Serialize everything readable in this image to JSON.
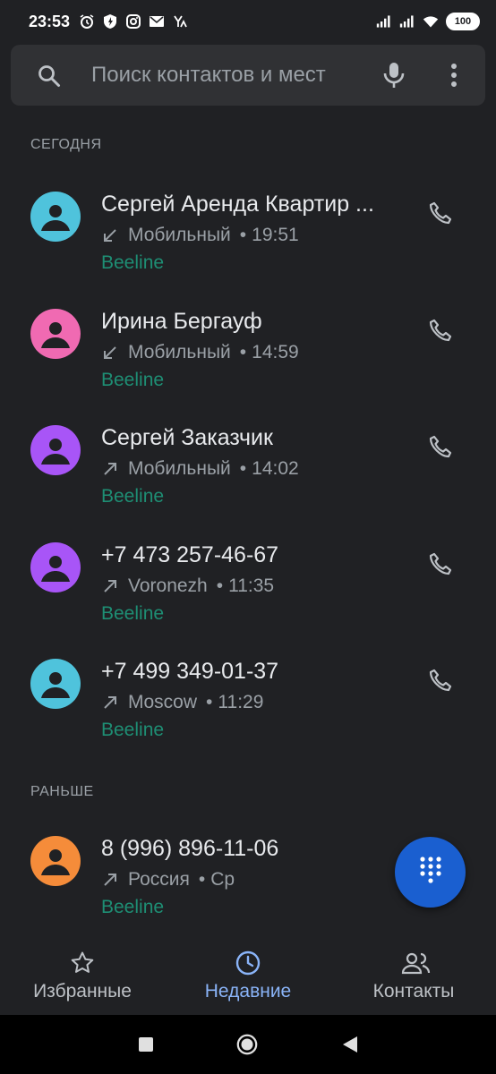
{
  "status_bar": {
    "time": "23:53",
    "battery": "100",
    "left_icons": [
      "alarm-icon",
      "shield-icon",
      "instagram-icon",
      "mail-icon",
      "yandex-icon"
    ],
    "right_icons": [
      "signal-icon",
      "signal-icon",
      "wifi-icon",
      "battery-icon"
    ]
  },
  "search": {
    "placeholder": "Поиск контактов и мест",
    "icons": [
      "search-icon",
      "mic-icon",
      "more-vert-icon"
    ]
  },
  "sections": {
    "today": "СЕГОДНЯ",
    "earlier": "РАНЬШЕ"
  },
  "calls": [
    {
      "name": "Сергей Аренда Квартир ...",
      "direction": "incoming",
      "type": "Мобильный",
      "sep": "•",
      "time": "19:51",
      "carrier": "Beeline",
      "avatar_color": "#4fc3dc"
    },
    {
      "name": "Ирина Бергауф",
      "direction": "incoming",
      "type": "Мобильный",
      "sep": "•",
      "time": "14:59",
      "carrier": "Beeline",
      "avatar_color": "#f06ab2"
    },
    {
      "name": "Сергей Заказчик",
      "direction": "outgoing",
      "type": "Мобильный",
      "sep": "•",
      "time": "14:02",
      "carrier": "Beeline",
      "avatar_color": "#a855f7"
    },
    {
      "name": "+7 473 257-46-67",
      "direction": "outgoing",
      "type": "Voronezh",
      "sep": "•",
      "time": "11:35",
      "carrier": "Beeline",
      "avatar_color": "#a855f7"
    },
    {
      "name": "+7 499 349-01-37",
      "direction": "outgoing",
      "type": "Moscow",
      "sep": "•",
      "time": "11:29",
      "carrier": "Beeline",
      "avatar_color": "#4fc3dc"
    },
    {
      "name": "8 (996) 896-11-06",
      "direction": "outgoing",
      "type": "Россия",
      "sep": "•",
      "time": "Ср",
      "carrier": "Beeline",
      "avatar_color": "#f58c3a"
    }
  ],
  "fab": {
    "icon": "dialpad-icon",
    "color": "#1a5fd0"
  },
  "bottom_nav": {
    "favorites": "Избранные",
    "recents": "Недавние",
    "contacts": "Контакты",
    "active": "recents"
  },
  "colors": {
    "background": "#202124",
    "carrier": "#1e8e74",
    "accent": "#8ab4f8"
  }
}
